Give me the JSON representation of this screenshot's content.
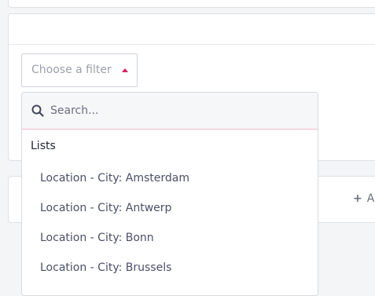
{
  "filter": {
    "placeholder": "Choose a filter",
    "accent_color": "#e0195f"
  },
  "dropdown": {
    "search_placeholder": "Search...",
    "search_value": "",
    "group_label": "Lists",
    "options": [
      "Location - City: Amsterdam",
      "Location - City: Antwerp",
      "Location - City: Bonn",
      "Location - City: Brussels"
    ]
  },
  "background_card": {
    "add_label": "A"
  }
}
